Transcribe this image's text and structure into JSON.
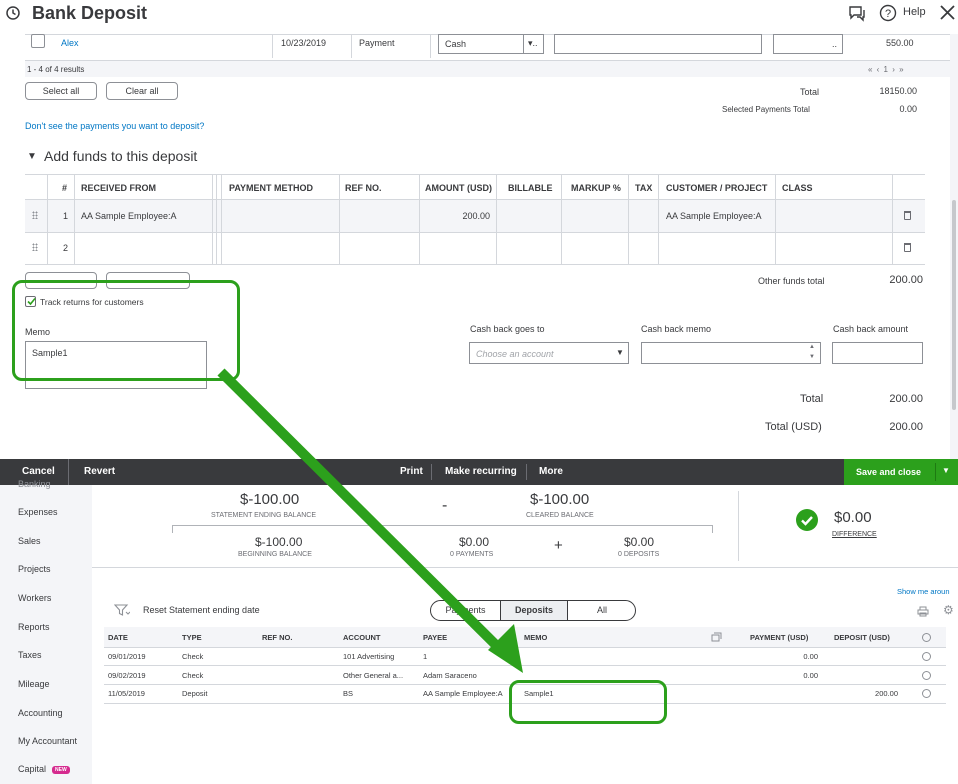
{
  "header": {
    "title": "Bank Deposit",
    "help_label": "Help"
  },
  "payments_row": {
    "name": "Alex",
    "date": "10/23/2019",
    "type": "Payment",
    "method": "Cash",
    "method_suffix": "▾..",
    "memo_suffix": "..",
    "amount": "550.00"
  },
  "pagination": {
    "results": "1 - 4 of 4 results",
    "nav": "« ‹ 1 › »"
  },
  "buttons": {
    "select_all": "Select all",
    "clear_all": "Clear all"
  },
  "totals_top": {
    "total_label": "Total",
    "total_value": "18150.00",
    "selected_label": "Selected Payments Total",
    "selected_value": "0.00"
  },
  "link_missing": "Don't see the payments you want to deposit?",
  "add_funds": {
    "title": "Add funds to this deposit",
    "columns": [
      "#",
      "RECEIVED FROM",
      "PAYMENT METHOD",
      "REF NO.",
      "AMOUNT (USD)",
      "BILLABLE",
      "MARKUP %",
      "TAX",
      "CUSTOMER / PROJECT",
      "CLASS"
    ],
    "rows": [
      {
        "num": "1",
        "received_from": "AA Sample Employee:A",
        "amount": "200.00",
        "customer": "AA Sample Employee:A"
      },
      {
        "num": "2",
        "received_from": "",
        "amount": "",
        "customer": ""
      }
    ],
    "other_funds_label": "Other funds total",
    "other_funds_value": "200.00"
  },
  "track_returns": "Track returns for customers",
  "memo": {
    "label": "Memo",
    "value": "Sample1"
  },
  "cash_back": {
    "goes_to_label": "Cash back goes to",
    "goes_to_placeholder": "Choose an account",
    "memo_label": "Cash back memo",
    "amount_label": "Cash back amount"
  },
  "totals_bottom": {
    "total_label": "Total",
    "total_value": "200.00",
    "total_usd_label": "Total (USD)",
    "total_usd_value": "200.00"
  },
  "footer": {
    "cancel": "Cancel",
    "revert": "Revert",
    "print": "Print",
    "make_recurring": "Make recurring",
    "more": "More",
    "save_close": "Save and close"
  },
  "sidebar": {
    "items": [
      "Banking",
      "Expenses",
      "Sales",
      "Projects",
      "Workers",
      "Reports",
      "Taxes",
      "Mileage",
      "Accounting",
      "My Accountant",
      "Capital"
    ],
    "new_badge": "NEW"
  },
  "reconcile": {
    "statement_ending_balance": "$-100.00",
    "statement_ending_label": "STATEMENT ENDING BALANCE",
    "minus": "-",
    "cleared_balance": "$-100.00",
    "cleared_label": "CLEARED BALANCE",
    "difference": "$0.00",
    "difference_label": "DIFFERENCE",
    "beginning_balance": "$-100.00",
    "beginning_label": "BEGINNING BALANCE",
    "payments": "$0.00",
    "payments_label": "0 PAYMENTS",
    "plus": "+",
    "deposits": "$0.00",
    "deposits_label": "0 DEPOSITS",
    "show_more": "Show me aroun",
    "reset_label": "Reset Statement ending date",
    "tabs": [
      "Payments",
      "Deposits",
      "All"
    ],
    "columns": [
      "DATE",
      "TYPE",
      "REF NO.",
      "ACCOUNT",
      "PAYEE",
      "MEMO",
      "PAYMENT (USD)",
      "DEPOSIT (USD)"
    ],
    "rows": [
      {
        "date": "09/01/2019",
        "type": "Check",
        "ref": "",
        "account": "101 Advertising",
        "payee": "1",
        "memo": "",
        "payment": "0.00",
        "deposit": ""
      },
      {
        "date": "09/02/2019",
        "type": "Check",
        "ref": "",
        "account": "Other General a...",
        "payee": "Adam Saraceno",
        "memo": "",
        "payment": "0.00",
        "deposit": ""
      },
      {
        "date": "11/05/2019",
        "type": "Deposit",
        "ref": "",
        "account": "BS",
        "payee": "AA Sample Employee:A",
        "memo": "Sample1",
        "payment": "",
        "deposit": "200.00"
      }
    ]
  },
  "colors": {
    "accent_green": "#2ca01c",
    "dark_bar": "#393a3d",
    "link_blue": "#0077c5"
  }
}
